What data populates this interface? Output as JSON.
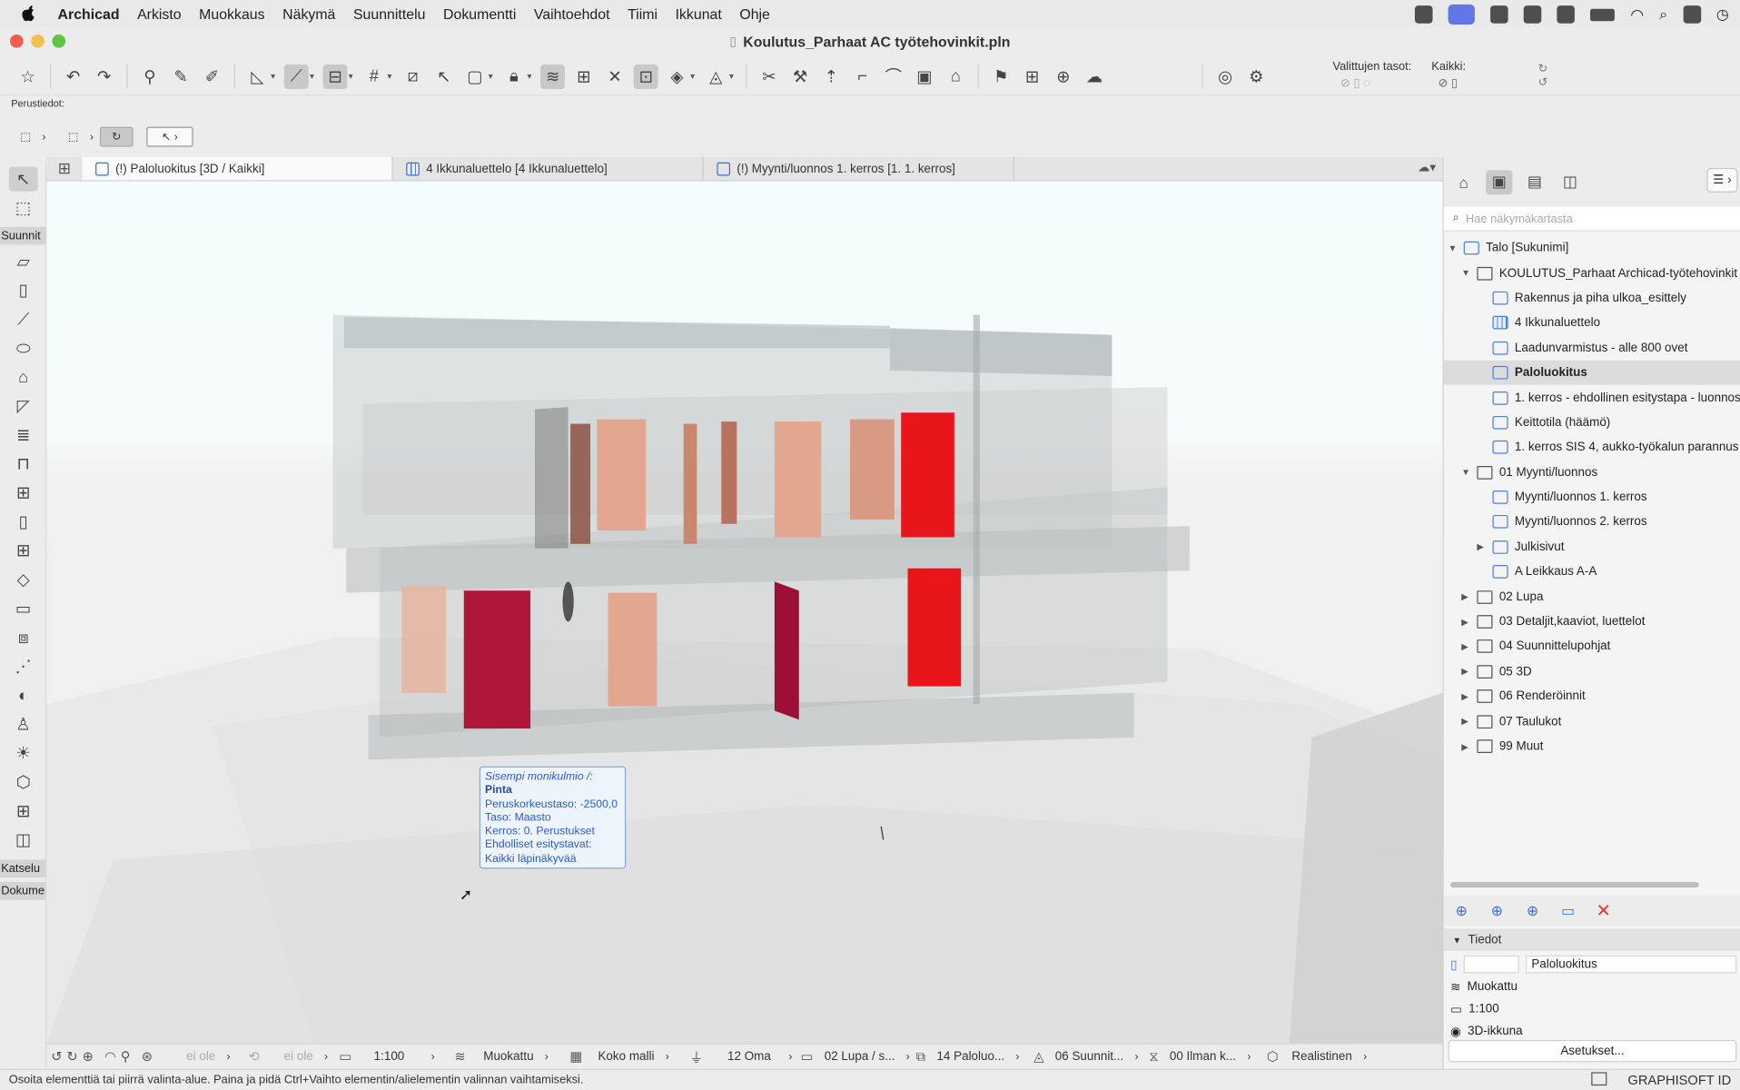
{
  "menubar": {
    "app_name": "Archicad",
    "items": [
      "Arkisto",
      "Muokkaus",
      "Näkymä",
      "Suunnittelu",
      "Dokumentti",
      "Vaihtoehdot",
      "Tiimi",
      "Ikkunat",
      "Ohje"
    ]
  },
  "window": {
    "title": "Koulutus_Parhaat AC työtehovinkit.pln"
  },
  "toolbar": {
    "selected_layers_label": "Valittujen tasot:",
    "all_label": "Kaikki:"
  },
  "infobox": {
    "label": "Perustiedot:"
  },
  "toolbox": {
    "section_design": "Suunnit",
    "section_view": "Katselu",
    "section_document": "Dokume"
  },
  "tabs": [
    {
      "label": "(!) Paloluokitus [3D / Kaikki]"
    },
    {
      "label": "4 Ikkunaluettelo [4 Ikkunaluettelo]"
    },
    {
      "label": "(!) Myynti/luonnos 1. kerros [1. 1. kerros]"
    }
  ],
  "tooltip": {
    "line1": "Sisempi monikulmio /:",
    "line2": "Pinta",
    "line3": "Peruskorkeustaso: -2500,0",
    "line4": "Taso: Maasto",
    "line5": "Kerros: 0. Perustukset",
    "line6": "Ehdolliset esitystavat:",
    "line7": "Kaikki läpinäkyvää"
  },
  "navigator": {
    "search_placeholder": "Hae näkymäkartasta",
    "tree": [
      {
        "label": "Talo [Sukunimi]"
      },
      {
        "label": "KOULUTUS_Parhaat Archicad-työtehovinkit"
      },
      {
        "label": "Rakennus ja piha ulkoa_esittely"
      },
      {
        "label": "4 Ikkunaluettelo"
      },
      {
        "label": "Laadunvarmistus - alle 800 ovet"
      },
      {
        "label": "Paloluokitus"
      },
      {
        "label": "1. kerros - ehdollinen esitystapa - luonnos"
      },
      {
        "label": "Keittotila (häämö)"
      },
      {
        "label": "1. kerros SIS 4, aukko-työkalun parannus"
      },
      {
        "label": "01 Myynti/luonnos"
      },
      {
        "label": "Myynti/luonnos 1. kerros"
      },
      {
        "label": "Myynti/luonnos 2. kerros"
      },
      {
        "label": "Julkisivut"
      },
      {
        "label": "A Leikkaus A-A"
      },
      {
        "label": "02 Lupa"
      },
      {
        "label": "03 Detaljit,kaaviot, luettelot"
      },
      {
        "label": "04 Suunnittelupohjat"
      },
      {
        "label": "05 3D"
      },
      {
        "label": "06 Renderöinnit"
      },
      {
        "label": "07 Taulukot"
      },
      {
        "label": "99 Muut"
      }
    ]
  },
  "properties": {
    "header": "Tiedot",
    "name_value": "Paloluokitus",
    "override": "Muokattu",
    "scale": "1:100",
    "view_type": "3D-ikkuna",
    "settings_button": "Asetukset..."
  },
  "bottom_bar": {
    "zoom_na_1": "ei ole",
    "zoom_na_2": "ei ole",
    "scale": "1:100",
    "layer_combo": "Muokattu",
    "model_view": "Koko malli",
    "pen_set": "12 Oma",
    "graphic_override": "02 Lupa / s...",
    "renovation": "14 Paloluo...",
    "dimension": "06 Suunnit...",
    "structure": "00 Ilman k...",
    "style": "Realistinen"
  },
  "status": {
    "message": "Osoita elementtiä tai piirrä valinta-alue. Paina ja pidä Ctrl+Vaihto elementin/alielementin valinnan vaihtamiseksi.",
    "brand": "GRAPHISOFT ID"
  },
  "colors": {
    "accent_blue": "#3d6fd9",
    "door_red": "#e8151b",
    "door_crimson": "#b0163a",
    "door_salmon": "#e3a68f"
  }
}
